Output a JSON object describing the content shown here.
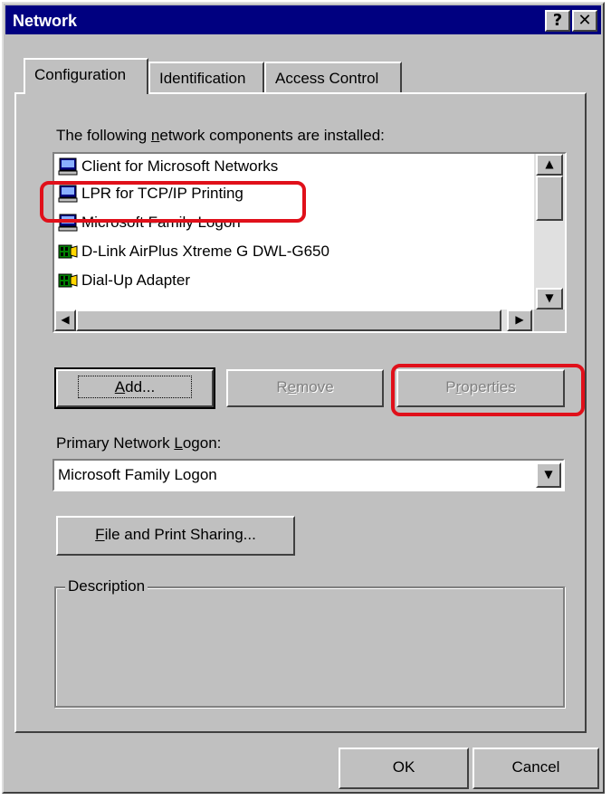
{
  "window": {
    "title": "Network",
    "help_label": "?",
    "close_label": "✕"
  },
  "tabs": [
    {
      "label": "Configuration",
      "active": true
    },
    {
      "label": "Identification",
      "active": false
    },
    {
      "label": "Access Control",
      "active": false
    }
  ],
  "components": {
    "label_pre": "The following ",
    "label_key": "n",
    "label_post": "etwork components are installed:",
    "items": [
      {
        "label": "Client for Microsoft Networks",
        "icon": "network-client-icon"
      },
      {
        "label": "LPR for TCP/IP Printing",
        "icon": "network-client-icon"
      },
      {
        "label": "Microsoft Family Logon",
        "icon": "network-client-icon"
      },
      {
        "label": "D-Link AirPlus Xtreme G DWL-G650",
        "icon": "network-adapter-icon"
      },
      {
        "label": "Dial-Up Adapter",
        "icon": "network-adapter-icon"
      }
    ]
  },
  "buttons": {
    "add_key": "A",
    "add_rest": "dd...",
    "remove_pre": "R",
    "remove_key": "e",
    "remove_post": "move",
    "properties_pre": "P",
    "properties_key": "r",
    "properties_post": "operties",
    "file_print_key": "F",
    "file_print_rest": "ile and Print Sharing...",
    "ok": "OK",
    "cancel": "Cancel"
  },
  "logon": {
    "label_pre": "Primary Network ",
    "label_key": "L",
    "label_post": "ogon:",
    "selected": "Microsoft Family Logon"
  },
  "description": {
    "title": "Description",
    "text": ""
  },
  "colors": {
    "title_bar": "#000080",
    "face": "#c0c0c0",
    "highlight_marker": "#e0101a"
  }
}
